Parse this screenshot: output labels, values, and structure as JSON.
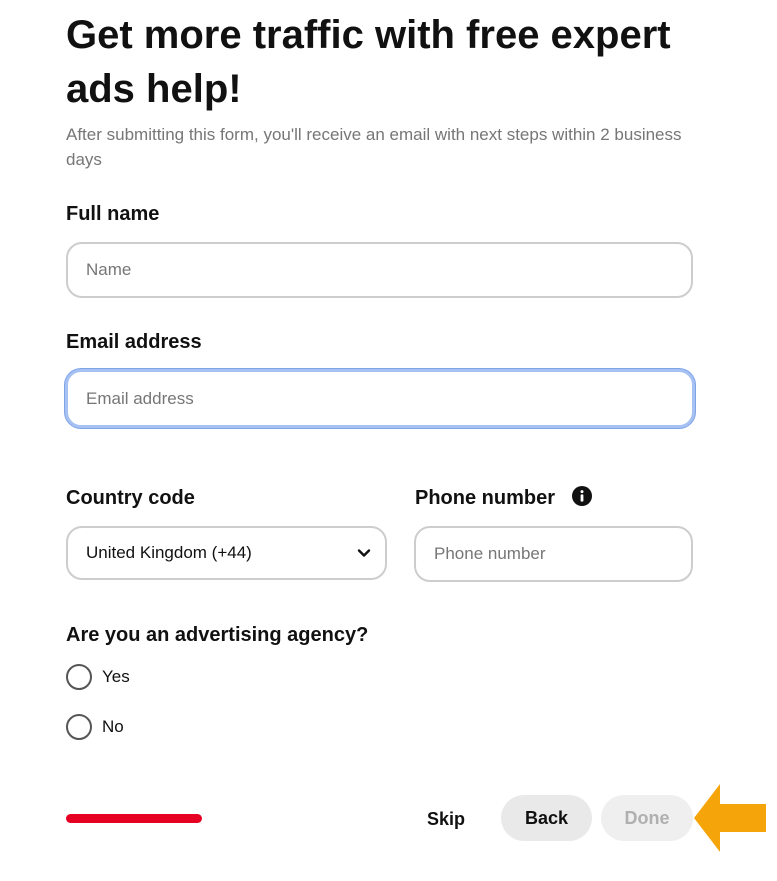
{
  "header": {
    "title": "Get more traffic with free expert ads help!",
    "subtitle": "After submitting this form, you'll receive an email with next steps within 2 business days"
  },
  "form": {
    "full_name": {
      "label": "Full name",
      "placeholder": "Name",
      "value": ""
    },
    "email": {
      "label": "Email address",
      "placeholder": "Email address",
      "value": ""
    },
    "country_code": {
      "label": "Country code",
      "selected": "United Kingdom (+44)"
    },
    "phone": {
      "label": "Phone number",
      "placeholder": "Phone number",
      "value": ""
    },
    "agency": {
      "question": "Are you an advertising agency?",
      "options": [
        "Yes",
        "No"
      ],
      "selected": null
    }
  },
  "progress": {
    "fraction": 0.2
  },
  "footer": {
    "skip_label": "Skip",
    "back_label": "Back",
    "done_label": "Done"
  },
  "colors": {
    "progress": "#e60023",
    "arrow": "#f5a50a",
    "focus_border": "#a6c1f2",
    "text_primary": "#111111",
    "text_secondary": "#767676"
  },
  "icons": {
    "info": "info-icon",
    "chevron": "chevron-down-icon",
    "arrow": "arrow-left-icon"
  }
}
